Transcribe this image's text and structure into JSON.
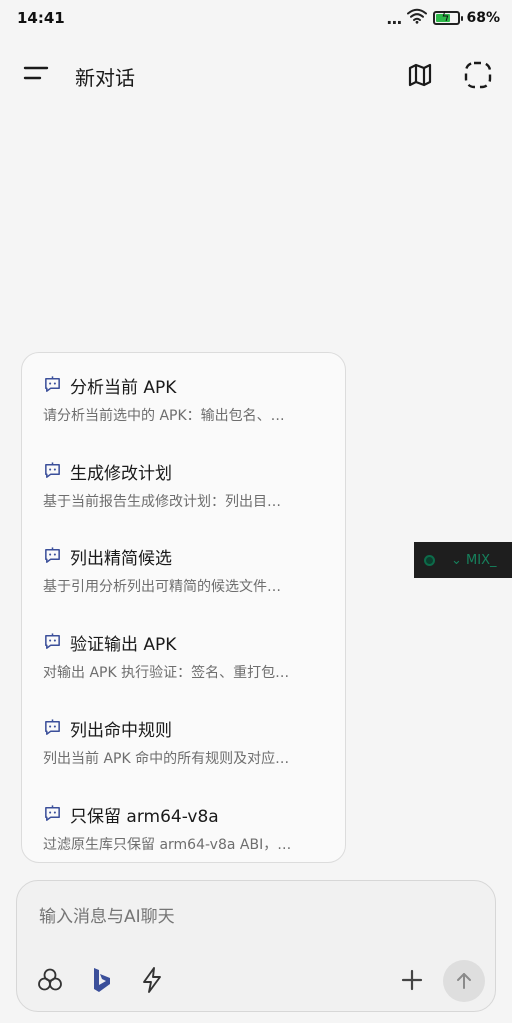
{
  "status_bar": {
    "time": "14:41",
    "dots": "...",
    "battery_percent": "68%",
    "battery_level": 0.68,
    "battery_color": "#2eb84a"
  },
  "header": {
    "title": "新对话",
    "icons": [
      "menu-icon",
      "map-icon",
      "dashed-select-icon"
    ]
  },
  "debug_chip": {
    "text": "⌄ MIX_"
  },
  "suggestions": [
    {
      "title": "分析当前 APK",
      "description": "请分析当前选中的 APK：输出包名、…",
      "icon": "chat-bot-icon"
    },
    {
      "title": "生成修改计划",
      "description": "基于当前报告生成修改计划：列出目…",
      "icon": "chat-bot-icon"
    },
    {
      "title": "列出精简候选",
      "description": "基于引用分析列出可精简的候选文件…",
      "icon": "chat-bot-icon"
    },
    {
      "title": "验证输出 APK",
      "description": "对输出 APK 执行验证：签名、重打包…",
      "icon": "chat-bot-icon"
    },
    {
      "title": "列出命中规则",
      "description": "列出当前 APK 命中的所有规则及对应…",
      "icon": "chat-bot-icon"
    },
    {
      "title": "只保留 arm64-v8a",
      "description": "过滤原生库只保留 arm64-v8a ABI，…",
      "icon": "chat-bot-icon"
    }
  ],
  "composer": {
    "placeholder": "输入消息与AI聊天",
    "tools": [
      "model-cluster-icon",
      "bing-icon",
      "lightning-icon"
    ],
    "add_icon": "plus-icon",
    "send_icon": "arrow-up-icon",
    "accent_color": "#3b4f9a"
  }
}
